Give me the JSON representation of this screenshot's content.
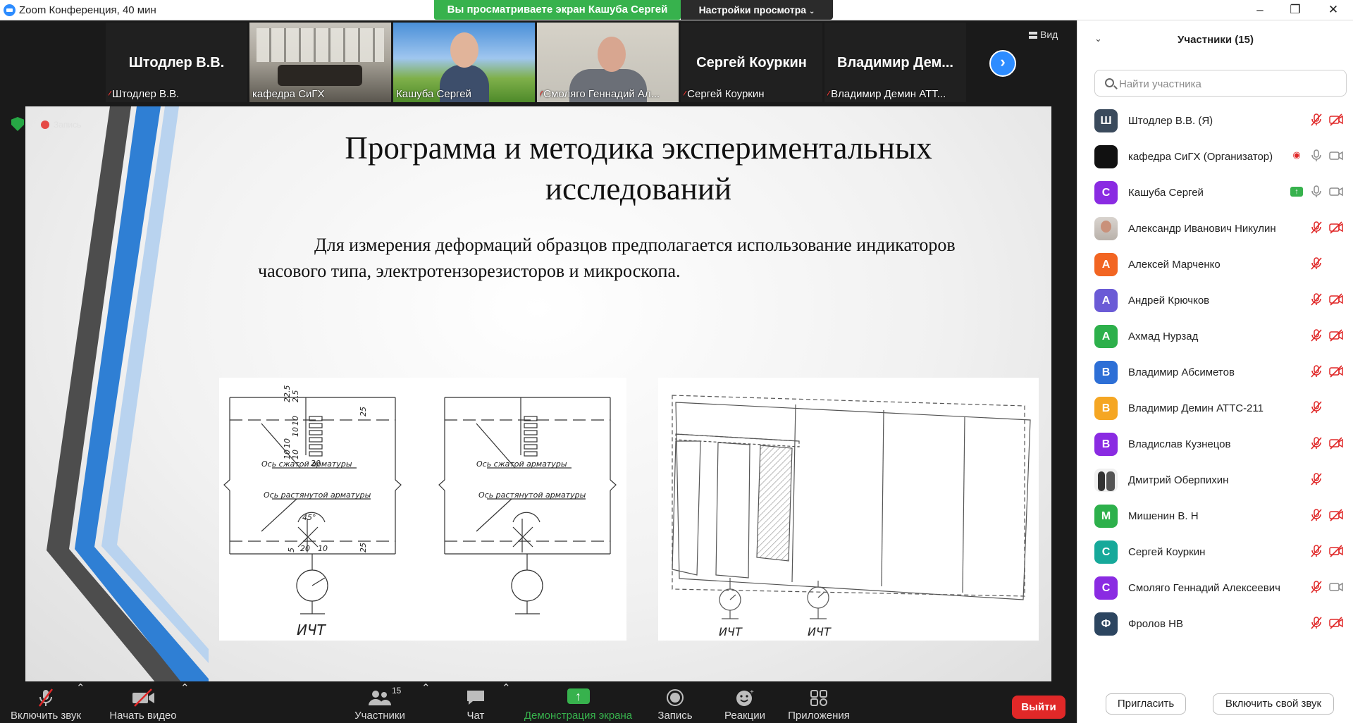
{
  "window": {
    "title": "Zoom Конференция, 40 мин",
    "minimize": "–",
    "restore": "❐",
    "close": "✕"
  },
  "banner": {
    "text": "Вы просматриваете экран Кашуба Сергей",
    "view_settings": "Настройки просмотра",
    "view_settings_chevron": "⌄"
  },
  "strip": {
    "tiles": [
      {
        "big_name": "Штодлер В.В.",
        "label": "Штодлер В.В.",
        "muted": true
      },
      {
        "label": "кафедра СиГХ",
        "muted": false,
        "video": "room"
      },
      {
        "label": "Кашуба Сергей",
        "muted": false,
        "video": "sky",
        "active": true
      },
      {
        "label": "Смоляго Геннадий Ал...",
        "muted": true,
        "video": "office"
      },
      {
        "big_name": "Сергей Коуркин",
        "label": "Сергей Коуркин",
        "muted": true
      },
      {
        "big_name": "Владимир Дем...",
        "label": "Владимир Демин АТТ...",
        "muted": true
      }
    ],
    "next_icon": "›",
    "view_label": "Вид"
  },
  "record_label": "Запись",
  "slide": {
    "title_line1": "Программа и методика экспериментальных",
    "title_line2": "исследований",
    "body": "Для измерения деформаций образцов предполагается использование индикаторов часового типа, электротензорезисторов и микроскопа.",
    "drawing1": {
      "axis_compressed": "Ось сжатой арматуры",
      "axis_tensile": "Ось растянутой арматуры",
      "gauge_label": "ИЧТ",
      "dims_vertical": [
        "22.5",
        "2.5",
        "10",
        "10",
        "10",
        "10",
        "10",
        "20"
      ],
      "dims_side": [
        "25",
        "25"
      ],
      "dims_bottom": [
        "5",
        "20",
        "10"
      ],
      "angle": "45°"
    },
    "drawing2": {
      "gauge_label_1": "ИЧТ",
      "gauge_label_2": "ИЧТ"
    }
  },
  "toolbar": {
    "mute": {
      "label": "Включить звук",
      "icon": "mic-off-icon"
    },
    "video": {
      "label": "Начать видео",
      "icon": "video-off-icon"
    },
    "participants": {
      "label": "Участники",
      "count": "15"
    },
    "chat": {
      "label": "Чат"
    },
    "share": {
      "label": "Демонстрация экрана"
    },
    "record": {
      "label": "Запись"
    },
    "reactions": {
      "label": "Реакции"
    },
    "apps": {
      "label": "Приложения"
    },
    "exit": {
      "label": "Выйти"
    },
    "caret": "⌃"
  },
  "panel": {
    "title": "Участники (15)",
    "collapse_icon": "⌄",
    "search_placeholder": "Найти участника",
    "invite": "Пригласить",
    "unmute_self": "Включить свой звук",
    "participants": [
      {
        "initial": "Ш",
        "name": "Штодлер В.В. (Я)",
        "color": "#3a4a5c",
        "mic": "off",
        "cam": "off"
      },
      {
        "initial": "",
        "name": "кафедра СиГХ (Организатор)",
        "color": "#111111",
        "mic": "on",
        "cam": "on",
        "rec": true
      },
      {
        "initial": "С",
        "name": "Кашуба Сергей",
        "color": "#8a2be2",
        "mic": "on",
        "cam": "on",
        "sharing": true
      },
      {
        "initial": "",
        "name": "Александр Иванович Никулин",
        "color": "photo",
        "mic": "off",
        "cam": "off"
      },
      {
        "initial": "А",
        "name": "Алексей Марченко",
        "color": "#f26522",
        "mic": "off",
        "cam": "none"
      },
      {
        "initial": "А",
        "name": "Андрей Крючков",
        "color": "#6b5bd6",
        "mic": "off",
        "cam": "off"
      },
      {
        "initial": "А",
        "name": "Ахмад Нурзад",
        "color": "#2db04b",
        "mic": "off",
        "cam": "off"
      },
      {
        "initial": "В",
        "name": "Владимир Абсиметов",
        "color": "#2d6fd6",
        "mic": "off",
        "cam": "off"
      },
      {
        "initial": "В",
        "name": "Владимир Демин АТТС-211",
        "color": "#f5a623",
        "mic": "off",
        "cam": "none"
      },
      {
        "initial": "В",
        "name": "Владислав Кузнецов",
        "color": "#8a2be2",
        "mic": "off",
        "cam": "off"
      },
      {
        "initial": "",
        "name": "Дмитрий Оберпихин",
        "color": "photo2",
        "mic": "off",
        "cam": "none"
      },
      {
        "initial": "М",
        "name": "Мишенин В. Н",
        "color": "#2db04b",
        "mic": "off",
        "cam": "off"
      },
      {
        "initial": "С",
        "name": "Сергей Коуркин",
        "color": "#16a99a",
        "mic": "off",
        "cam": "off"
      },
      {
        "initial": "С",
        "name": "Смоляго Геннадий Алексеевич",
        "color": "#8a2be2",
        "mic": "off",
        "cam": "on"
      },
      {
        "initial": "Ф",
        "name": "Фролов НВ",
        "color": "#2c4560",
        "mic": "off",
        "cam": "off"
      }
    ]
  }
}
